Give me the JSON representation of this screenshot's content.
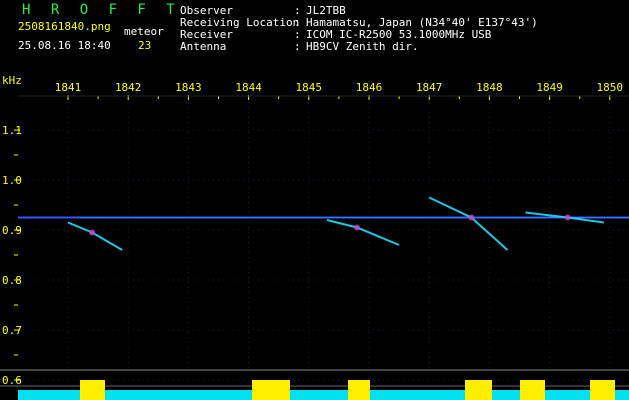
{
  "header": {
    "app_title": "H R O F F T",
    "file_name": "2508161840.png",
    "date_time": "25.08.16 18:40",
    "meteor_label": "meteor",
    "meteor_count": "23",
    "info": [
      {
        "key": "Observer",
        "value": "JL2TBB"
      },
      {
        "key": "Receiving Location",
        "value": "Hamamatsu, Japan (N34°40' E137°43')"
      },
      {
        "key": "Receiver",
        "value": "ICOM IC-R2500 53.1000MHz USB"
      },
      {
        "key": "Antenna",
        "value": "HB9CV Zenith dir."
      }
    ]
  },
  "colors": {
    "title": "#22ee44",
    "file_and_count": "#ffff00",
    "text": "#ffffff",
    "tick_text": "#ffff00",
    "axis": "#ffff00",
    "carrier": "#3355ff",
    "echo": "#22ddff",
    "bottom_fill": "#00e0f0",
    "bottom_peak": "#ffee00"
  },
  "chart_data": {
    "type": "heatmap",
    "x_ticks": [
      "1841",
      "1842",
      "1843",
      "1844",
      "1845",
      "1846",
      "1847",
      "1848",
      "1849",
      "1850"
    ],
    "y_unit": "kHz",
    "y_ticks": [
      "1.1",
      "1.0",
      "0.9",
      "0.8",
      "0.7",
      "0.6"
    ],
    "y_values": [
      1.1,
      1.0,
      0.9,
      0.8,
      0.7,
      0.6
    ],
    "carrier_khz": 0.925,
    "echoes": [
      {
        "x": [
          1841.0,
          1841.4,
          1841.9
        ],
        "y": [
          0.915,
          0.895,
          0.86
        ]
      },
      {
        "x": [
          1845.3,
          1845.8,
          1846.5
        ],
        "y": [
          0.92,
          0.905,
          0.87
        ]
      },
      {
        "x": [
          1847.0,
          1847.7,
          1848.3
        ],
        "y": [
          0.965,
          0.925,
          0.86
        ]
      },
      {
        "x": [
          1848.6,
          1849.3,
          1849.9
        ],
        "y": [
          0.935,
          0.925,
          0.915
        ]
      }
    ]
  }
}
